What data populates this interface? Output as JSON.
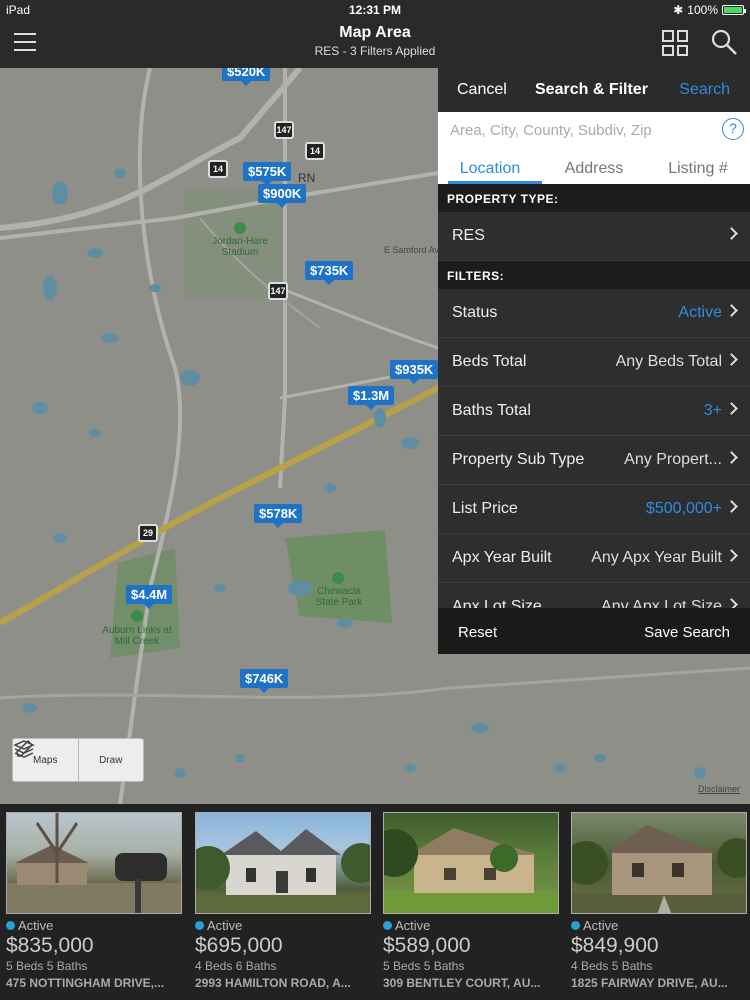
{
  "status_bar": {
    "device": "iPad",
    "time": "12:31 PM",
    "battery": "100%"
  },
  "nav": {
    "title": "Map Area",
    "subtitle": "RES - 3 Filters Applied"
  },
  "map": {
    "pins": [
      {
        "label": "$520K",
        "id": "520k"
      },
      {
        "label": "$575K",
        "id": "575k"
      },
      {
        "label": "$900K",
        "id": "900k"
      },
      {
        "label": "$735K",
        "id": "735k"
      },
      {
        "label": "$935K",
        "id": "935k"
      },
      {
        "label": "$1.3M",
        "id": "1-3m"
      },
      {
        "label": "$578K",
        "id": "578k"
      },
      {
        "label": "$4.4M",
        "id": "4-4m"
      },
      {
        "label": "$746K",
        "id": "746k"
      }
    ],
    "shields": [
      "147",
      "14",
      "14",
      "147",
      "29"
    ],
    "labels": {
      "stadium": "Jordan-Hare Stadium",
      "road": "E Samford Ave",
      "park": "Chewacla State Park",
      "golf": "Auburn Links at Mill Creek",
      "town": "RN"
    },
    "disclaimer": "Disclaimer",
    "tools": {
      "maps": "Maps",
      "draw": "Draw"
    }
  },
  "filter_panel": {
    "cancel": "Cancel",
    "title": "Search & Filter",
    "search": "Search",
    "search_placeholder": "Area, City, County, Subdiv, Zip",
    "help": "?",
    "tabs": [
      "Location",
      "Address",
      "Listing #"
    ],
    "property_type_header": "PROPERTY TYPE:",
    "property_type": "RES",
    "filters_header": "FILTERS:",
    "filters": [
      {
        "label": "Status",
        "value": "Active",
        "highlight": true
      },
      {
        "label": "Beds Total",
        "value": "Any Beds Total",
        "highlight": false
      },
      {
        "label": "Baths Total",
        "value": "3+",
        "highlight": true
      },
      {
        "label": "Property Sub Type",
        "value": "Any Propert...",
        "highlight": false
      },
      {
        "label": "List Price",
        "value": "$500,000+",
        "highlight": true
      },
      {
        "label": "Apx Year Built",
        "value": "Any Apx Year Built",
        "highlight": false
      },
      {
        "label": "Apx Lot Size",
        "value": "Any Apx Lot Size",
        "highlight": false
      }
    ],
    "reset": "Reset",
    "save_search": "Save Search"
  },
  "listings": [
    {
      "status": "Active",
      "price": "$835,000",
      "beds": "5 Beds 5 Baths",
      "address": "475 NOTTINGHAM DRIVE,..."
    },
    {
      "status": "Active",
      "price": "$695,000",
      "beds": "4 Beds 6 Baths",
      "address": "2993 HAMILTON ROAD, A..."
    },
    {
      "status": "Active",
      "price": "$589,000",
      "beds": "5 Beds 5 Baths",
      "address": "309 BENTLEY COURT, AU..."
    },
    {
      "status": "Active",
      "price": "$849,900",
      "beds": "4 Beds 5 Baths",
      "address": "1825 FAIRWAY DRIVE, AU..."
    }
  ],
  "colors": {
    "accent": "#2f8be0",
    "pin": "#1e73c7",
    "status_dot": "#2aa1d6"
  }
}
